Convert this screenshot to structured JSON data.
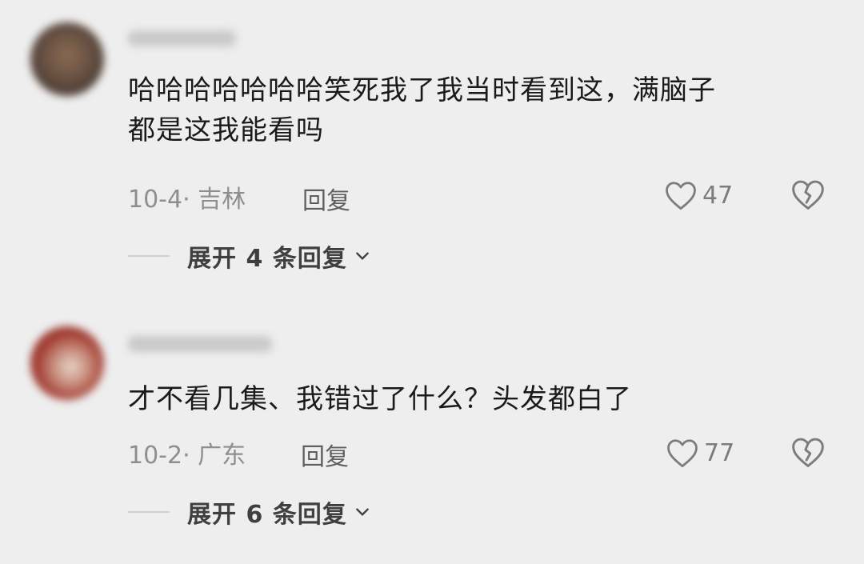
{
  "comments": [
    {
      "text": "哈哈哈哈哈哈哈笑死我了我当时看到这，满脑子都是这我能看吗",
      "text_line1": "哈哈哈哈哈哈哈笑死我了我当时看到这，满脑子",
      "text_line2": "都是这我能看吗",
      "date_location": "10-4· 吉林",
      "reply_label": "回复",
      "likes": "47",
      "expand_label": "展开 4 条回复"
    },
    {
      "text": "才不看几集、我错过了什么？头发都白了",
      "date_location": "10-2· 广东",
      "reply_label": "回复",
      "likes": "77",
      "expand_label": "展开 6 条回复"
    }
  ],
  "icons": {
    "like": "heart-outline-icon",
    "dislike": "broken-heart-icon",
    "expand": "chevron-down-icon"
  },
  "colors": {
    "background": "#eeeeee",
    "text": "#1a1a1a",
    "meta": "#8e8e8e",
    "icon": "#7c7c7c"
  }
}
